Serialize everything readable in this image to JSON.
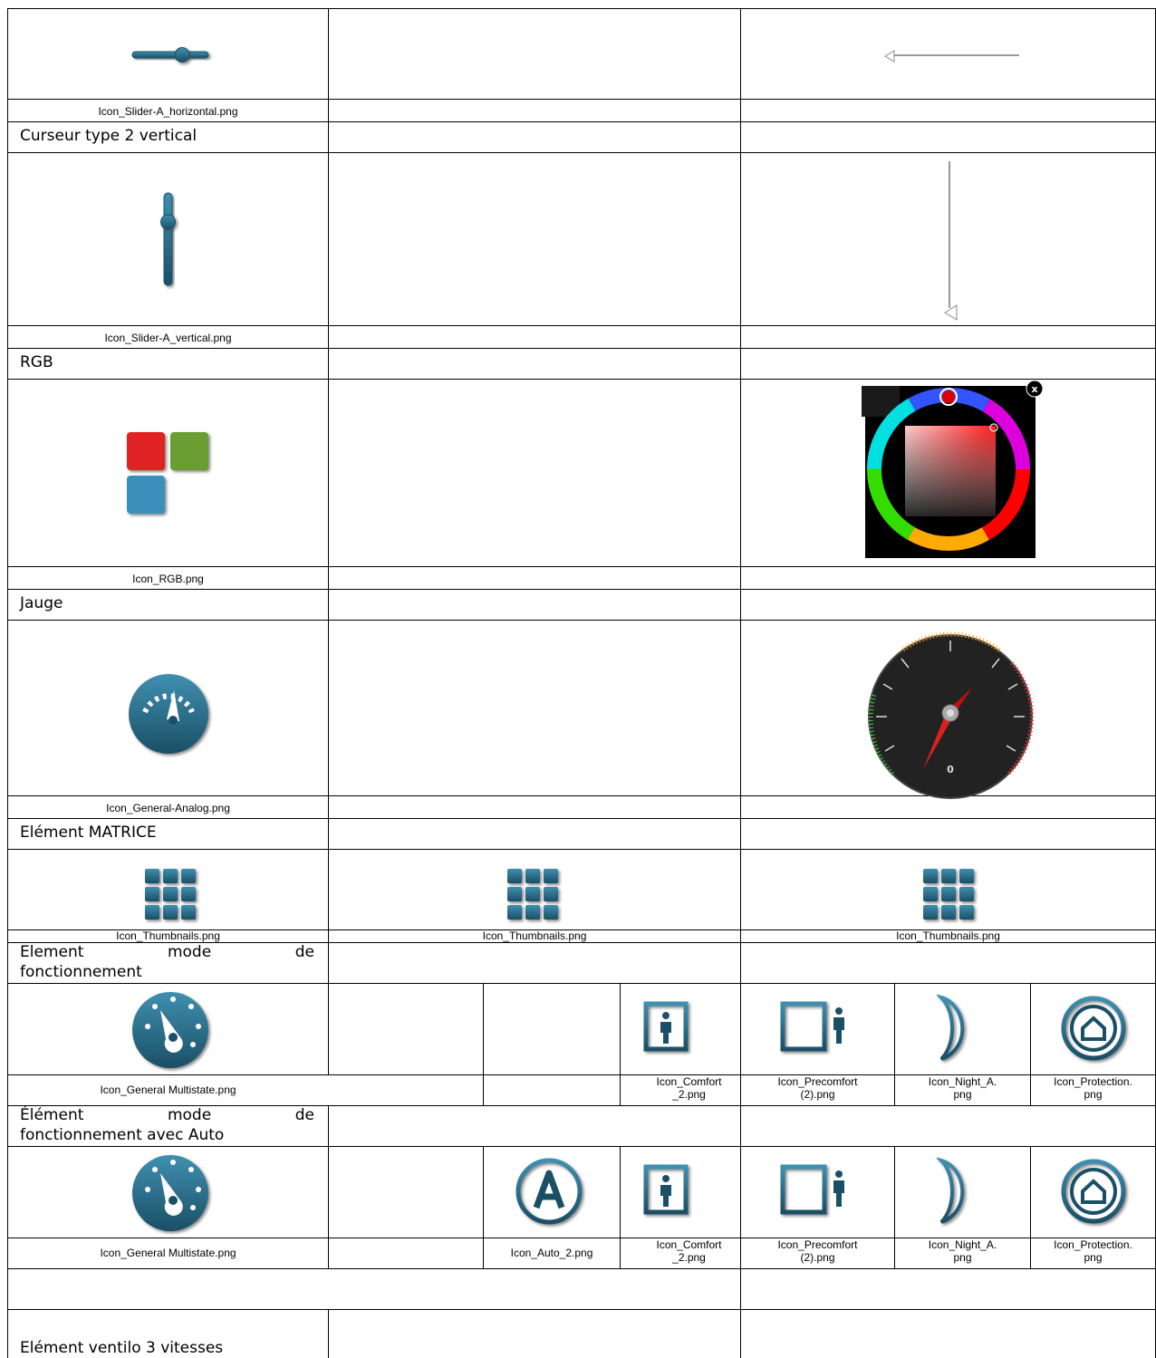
{
  "rows": {
    "slider_h_caption": "Icon_Slider-A_horizontal.png",
    "slider_v_heading": "Curseur type 2 vertical",
    "slider_v_caption": "Icon_Slider-A_vertical.png",
    "rgb_heading": "RGB",
    "rgb_caption": "Icon_RGB.png",
    "gauge_heading": "Jauge",
    "gauge_caption": "Icon_General-Analog.png",
    "gauge_value": "0",
    "color_picker_close": "x",
    "matrix_heading": "Elément MATRICE",
    "matrix_captions": [
      "Icon_Thumbnails.png",
      "Icon_Thumbnails.png",
      "Icon_Thumbnails.png"
    ],
    "mode_heading_line1": [
      "Element",
      "mode",
      "de"
    ],
    "mode_heading_line2": "fonctionnement",
    "mode_captions": [
      "Icon_General Multistate.png",
      "Icon_Comfort\n_2.png",
      "Icon_Precomfort\n(2).png",
      "Icon_Night_A.\npng",
      "Icon_Protection.\npng"
    ],
    "auto_heading_line1": [
      "Élément",
      "mode",
      "de"
    ],
    "auto_heading_line2": "fonctionnement avec Auto",
    "auto_captions": [
      "Icon_General Multistate.png",
      "Icon_Auto_2.png",
      "Icon_Comfort\n_2.png",
      "Icon_Precomfort\n(2).png",
      "Icon_Night_A.\npng",
      "Icon_Protection.\npng"
    ],
    "fan_heading": "Elément ventilo 3 vitesses"
  },
  "colors": {
    "icon_teal": "#2a6f8f",
    "icon_dark": "#1b4f66",
    "rgb_red": "#e02424",
    "rgb_green": "#6a9e30",
    "rgb_blue": "#3b8fbb"
  },
  "icons": [
    "slider-horizontal-icon",
    "slider-vertical-icon",
    "rgb-icon",
    "gauge-icon",
    "thumbnails-icon",
    "multistate-icon",
    "comfort-icon",
    "precomfort-icon",
    "night-icon",
    "protection-icon",
    "auto-icon"
  ]
}
